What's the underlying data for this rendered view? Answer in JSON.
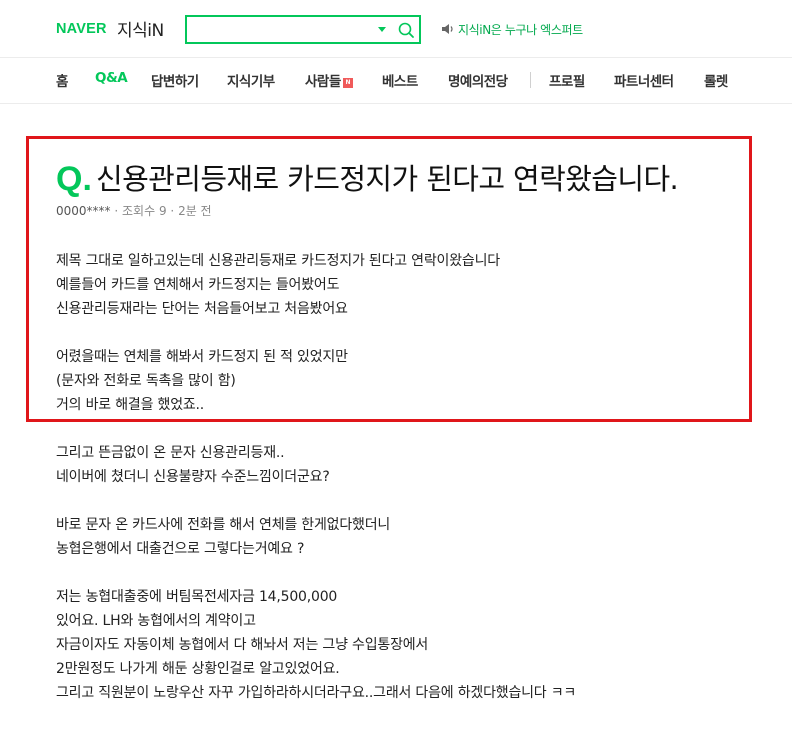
{
  "header": {
    "logo_naver": "NAVER",
    "logo_kin": "지식iN",
    "search_value": "",
    "notice": "지식iN은 누구나 엑스퍼트"
  },
  "nav": {
    "items": [
      "홈",
      "Q&A",
      "답변하기",
      "지식기부",
      "사람들",
      "베스트",
      "명예의전당",
      "프로필",
      "파트너센터",
      "롤렛"
    ],
    "active": "Q&A",
    "badge": "N"
  },
  "question": {
    "mark": "Q.",
    "title": "신용관리등재로 카드정지가 된다고 연락왔습니다.",
    "author": "0000****",
    "views": "조회수 9",
    "time": "2분 전",
    "lines": [
      "제목 그대로 일하고있는데 신용관리등재로 카드정지가 된다고 연락이왔습니다",
      "예를들어 카드를 연체해서 카드정지는 들어봤어도",
      "신용관리등재라는 단어는 처음들어보고 처음봤어요",
      "",
      "어렸을때는 연체를 해봐서 카드정지 된 적 있었지만",
      "(문자와 전화로 독촉을 많이 함)",
      "거의 바로 해결을 했었죠..",
      "",
      "그리고 뜬금없이 온 문자 신용관리등재..",
      "네이버에 쳤더니 신용불량자 수준느낌이더군요?",
      "",
      "바로 문자 온 카드사에 전화를 해서 연체를 한게없다했더니",
      "농협은행에서 대출건으로 그렇다는거예요 ?",
      "",
      "저는 농협대출중에 버팀목전세자금 14,500,000",
      "있어요. LH와 농협에서의 계약이고",
      "자금이자도 자동이체 농협에서 다 해놔서 저는 그냥 수입통장에서",
      "2만원정도 나가게 해둔 상황인걸로 알고있었어요.",
      "그리고 직원분이 노랑우산 자꾸 가입하라하시더라구요..그래서 다음에 하겠다했습니다 ㅋㅋ"
    ]
  },
  "colors": {
    "brand": "#03c75a",
    "highlight_border": "#e0161a"
  }
}
